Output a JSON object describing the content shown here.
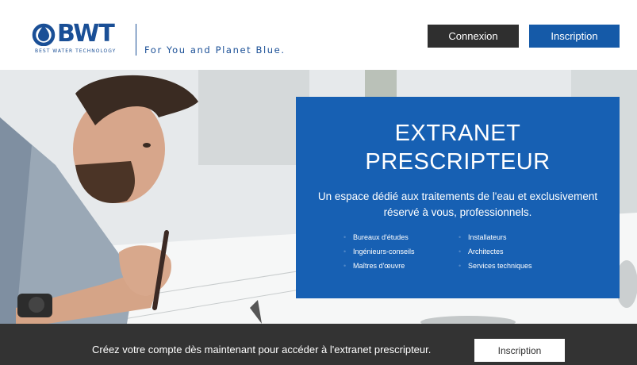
{
  "header": {
    "logo_text": "BWT",
    "logo_subtext": "BEST WATER TECHNOLOGY",
    "tagline": "For You and Planet Blue.",
    "login_label": "Connexion",
    "signup_label": "Inscription"
  },
  "hero": {
    "title_line1": "EXTRANET",
    "title_line2": "PRESCRIPTEUR",
    "description": "Un espace dédié aux traitements de l'eau et exclusivement réservé à vous, professionnels.",
    "list_left": [
      "Bureaux d'études",
      "Ingénieurs-conseils",
      "Maîtres d'œuvre"
    ],
    "list_right": [
      "Installateurs",
      "Architectes",
      "Services techniques"
    ]
  },
  "footer": {
    "cta_text": "Créez votre compte dès maintenant pour accéder à l'extranet prescripteur.",
    "signup_label": "Inscription"
  },
  "colors": {
    "brand_blue": "#1a4f96",
    "button_blue": "#155aa8",
    "panel_blue": "#1760b3",
    "dark": "#2f2f2f",
    "footer_bg": "#333333"
  }
}
